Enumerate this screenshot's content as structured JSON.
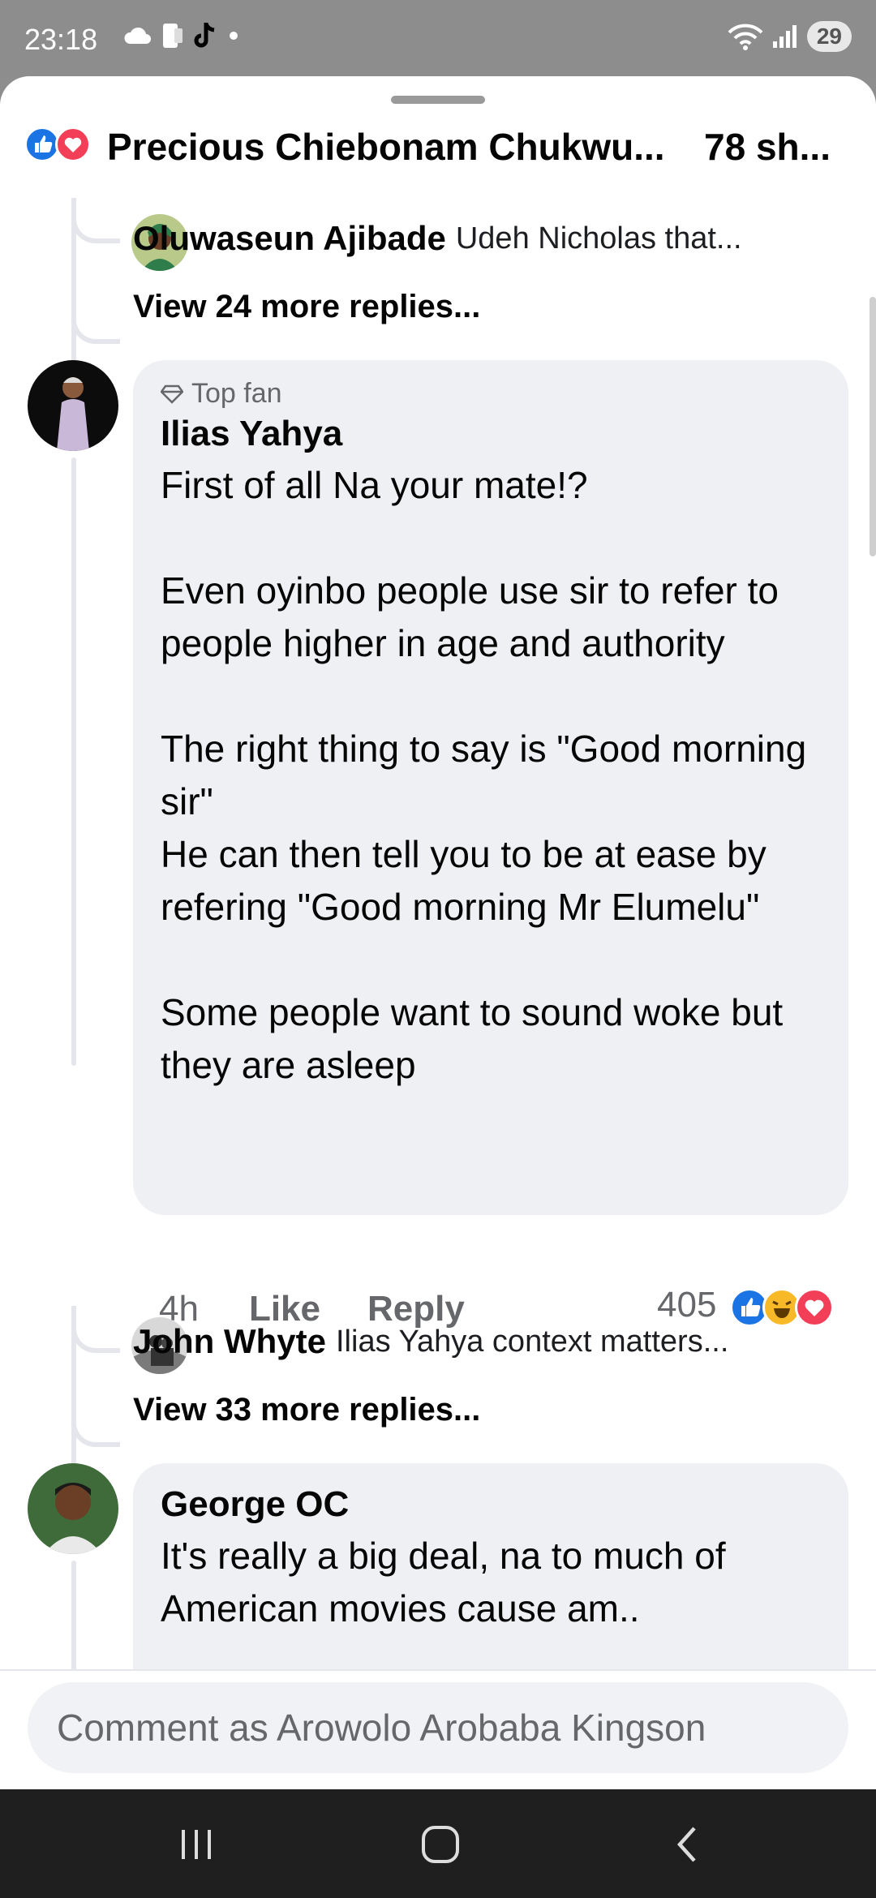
{
  "status_bar": {
    "time": "23:18",
    "battery": "29"
  },
  "header": {
    "title": "Precious Chiebonam Chukwu...",
    "shares": "78 sh..."
  },
  "replies_top": {
    "name": "Oluwaseun Ajibade",
    "text": "Udeh Nicholas that...",
    "view_more": "View 24 more replies..."
  },
  "comment_main": {
    "badge": "Top fan",
    "name": "Ilias Yahya",
    "text": "First of all Na your mate!?\n\nEven oyinbo people use sir to refer to people higher in age and authority\n\nThe right thing to say is \"Good morning sir\"\nHe can then tell you to be at ease by refering \"Good morning Mr Elumelu\"\n\nSome people want to sound woke but they are asleep",
    "time": "4h",
    "like_label": "Like",
    "reply_label": "Reply",
    "reaction_count": "405"
  },
  "replies_main": {
    "name": "John Whyte",
    "text": "Ilias Yahya context matters...",
    "view_more": "View 33 more replies..."
  },
  "comment_next": {
    "name": "George OC",
    "text": "It's really a big deal, na to much of American movies cause am.."
  },
  "composer": {
    "placeholder": "Comment as Arowolo Arobaba Kingson"
  },
  "colors": {
    "like_blue": "#1b74e4",
    "love_red": "#f33e58",
    "haha_yellow": "#f7b928"
  }
}
